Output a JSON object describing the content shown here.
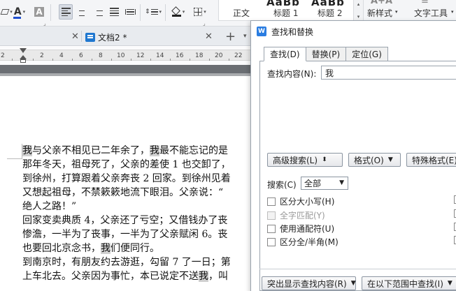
{
  "ribbon": {
    "font_color_label": "A",
    "highlight_label": "A",
    "styles": {
      "items": [
        "正文",
        "标题 1",
        "标题 2"
      ],
      "previews": [
        "AaBb",
        "AaBb"
      ]
    },
    "new_style_label": "新样式",
    "text_tools_label": "文字工具"
  },
  "tabs": {
    "doc2_title": "文档2 *"
  },
  "ruler": {
    "numbers": [
      "2",
      "2",
      "4",
      "6",
      "8",
      "10",
      "12",
      "14",
      "16",
      "18",
      "20",
      "22"
    ]
  },
  "document": {
    "paragraphs": [
      [
        {
          "t": "我",
          "hl": true
        },
        {
          "t": "与父亲不相见已二年余了，"
        },
        {
          "t": "我",
          "hl": true
        },
        {
          "t": "最不能忘记的是"
        }
      ],
      [
        {
          "t": "那年冬天，祖母死了，父亲的差使 1 也交卸了，"
        }
      ],
      [
        {
          "t": "到徐州，打算跟着父亲奔丧 2 回家。到徐州见着"
        }
      ],
      [
        {
          "t": "又想起祖母，不禁簌簌地流下眼泪。父亲说：“"
        }
      ],
      [
        {
          "t": "绝人之路！”"
        }
      ],
      [
        {
          "t": "回家变卖典质 4，父亲还了亏空；又借钱办了丧"
        }
      ],
      [
        {
          "t": "惨澹，一半为了丧事，一半为了父亲赋闲 6。丧"
        }
      ],
      [
        {
          "t": "也要回北京念书，"
        },
        {
          "t": "我",
          "hl": true
        },
        {
          "t": "们便同行。"
        }
      ],
      [
        {
          "t": "到南京时，有朋友约去游逛，勾留 7 了一日；第"
        }
      ],
      [
        {
          "t": "上车北去。父亲因为事忙，本已说定不送"
        },
        {
          "t": "我",
          "hl": true
        },
        {
          "t": "，叫"
        }
      ]
    ]
  },
  "dialog": {
    "title": "查找和替换",
    "tabs": [
      "查找(D)",
      "替换(P)",
      "定位(G)"
    ],
    "find_label": "查找内容(N):",
    "find_value": "我",
    "advanced_search": "高级搜索(L)",
    "format_button": "格式(O)",
    "special_format": "特殊格式(E)",
    "search_label": "搜索(C)",
    "search_scope": "全部",
    "options": [
      {
        "label": "区分大小写(H)",
        "disabled": false
      },
      {
        "label": "全字匹配(Y)",
        "disabled": true
      },
      {
        "label": "使用通配符(U)",
        "disabled": false
      },
      {
        "label": "区分全/半角(M)",
        "disabled": false
      }
    ],
    "highlight_all": "突出显示查找内容(R)",
    "find_in": "在以下范围中查找(I)"
  },
  "colors": {
    "accent": "#1f77d0",
    "highlight": "#d0d0d0",
    "font_color_bar": "#1f4fd0"
  }
}
